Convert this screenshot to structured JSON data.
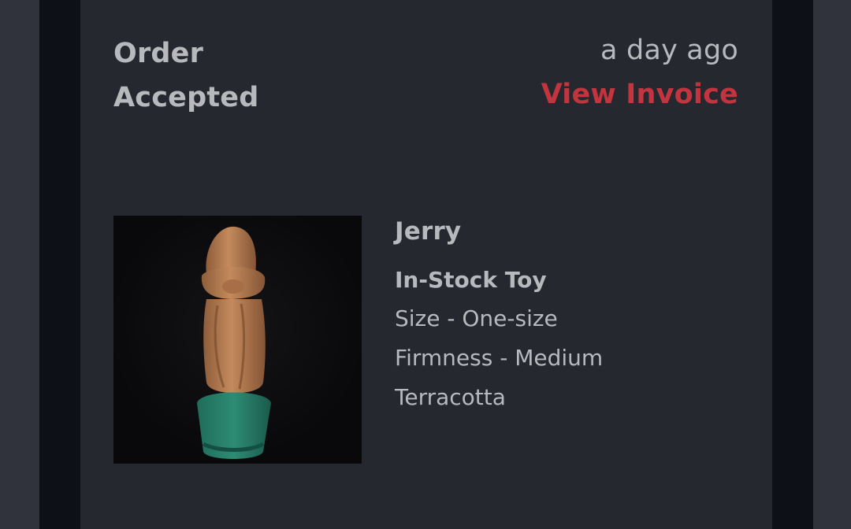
{
  "order": {
    "status": "Order Accepted",
    "time": "a day ago",
    "invoice_link": "View Invoice"
  },
  "product": {
    "name": "Jerry",
    "type": "In-Stock Toy",
    "size": "Size - One-size",
    "firmness": "Firmness - Medium",
    "color": "Terracotta"
  },
  "colors": {
    "link": "#c4343e",
    "text": "#b7b9bd",
    "card": "#25282f",
    "frame": "#0d1016",
    "background": "#30333b"
  }
}
